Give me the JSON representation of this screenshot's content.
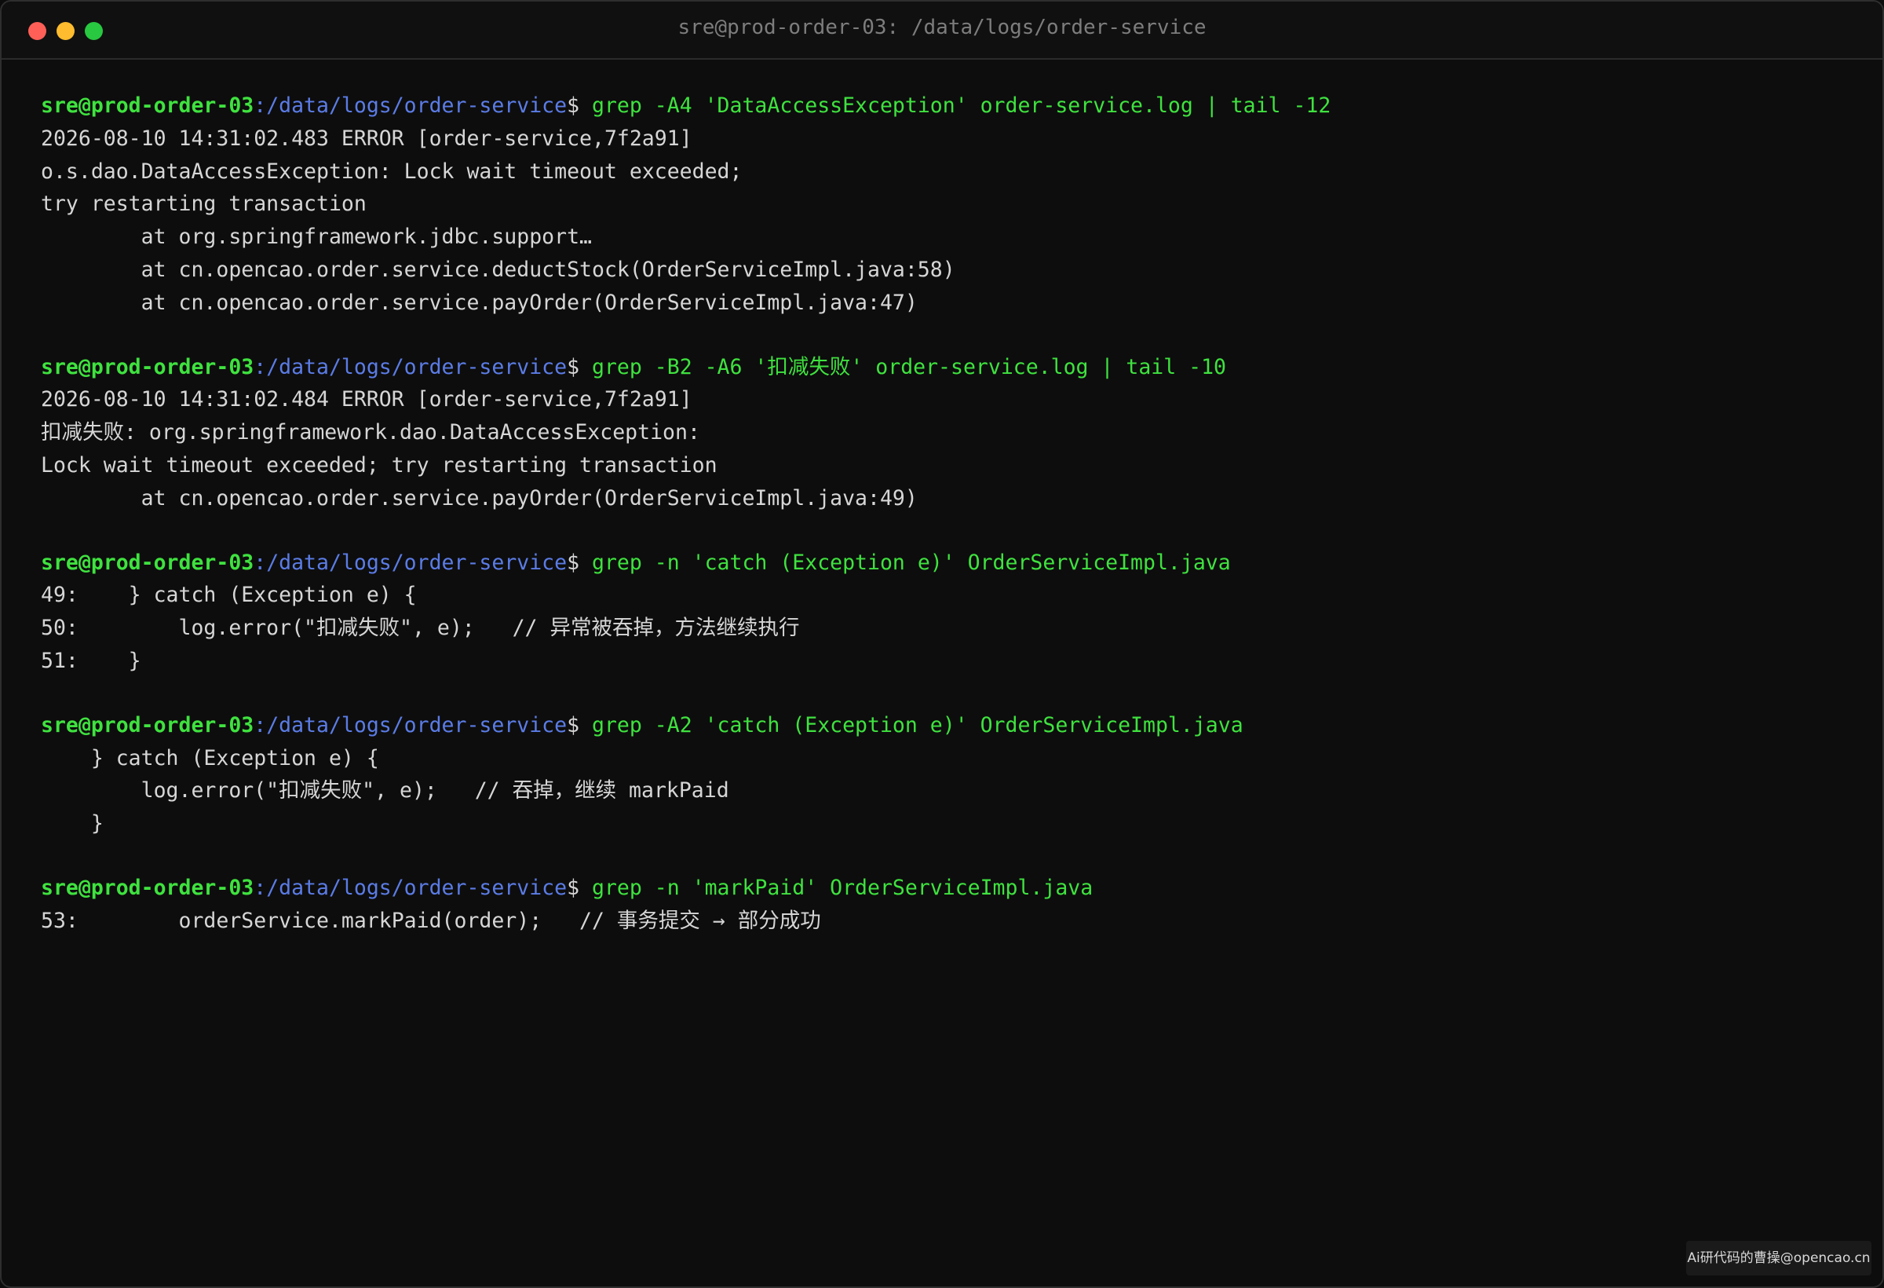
{
  "window": {
    "title": "sre@prod-order-03: /data/logs/order-service"
  },
  "prompt": {
    "user": "sre@prod-order-03",
    "path": ":/data/logs/order-service",
    "symbol": "$"
  },
  "blocks": [
    {
      "command": " grep -A4 'DataAccessException' order-service.log | tail -12",
      "output": [
        "2026-08-10 14:31:02.483 ERROR [order-service,7f2a91]",
        "o.s.dao.DataAccessException: Lock wait timeout exceeded;",
        "try restarting transaction",
        "        at org.springframework.jdbc.support…",
        "        at cn.opencao.order.service.deductStock(OrderServiceImpl.java:58)",
        "        at cn.opencao.order.service.payOrder(OrderServiceImpl.java:47)"
      ]
    },
    {
      "command": " grep -B2 -A6 '扣减失败' order-service.log | tail -10",
      "output": [
        "2026-08-10 14:31:02.484 ERROR [order-service,7f2a91]",
        "扣减失败: org.springframework.dao.DataAccessException:",
        "Lock wait timeout exceeded; try restarting transaction",
        "        at cn.opencao.order.service.payOrder(OrderServiceImpl.java:49)"
      ]
    },
    {
      "command": " grep -n 'catch (Exception e)' OrderServiceImpl.java",
      "output": [
        "49:    } catch (Exception e) {",
        "50:        log.error(\"扣减失败\", e);   // 异常被吞掉，方法继续执行",
        "51:    }"
      ]
    },
    {
      "command": " grep -A2 'catch (Exception e)' OrderServiceImpl.java",
      "output": [
        "    } catch (Exception e) {",
        "        log.error(\"扣减失败\", e);   // 吞掉，继续 markPaid",
        "    }"
      ]
    },
    {
      "command": " grep -n 'markPaid' OrderServiceImpl.java",
      "output": [
        "53:        orderService.markPaid(order);   // 事务提交 → 部分成功"
      ]
    }
  ],
  "watermark": "Ai研代码的曹操@opencao.cn",
  "colors": {
    "background": "#0d0d0d",
    "prompt_user": "#3fe23f",
    "prompt_path": "#5b7ce6",
    "command": "#3fe23f",
    "output": "#d6d6d6"
  }
}
